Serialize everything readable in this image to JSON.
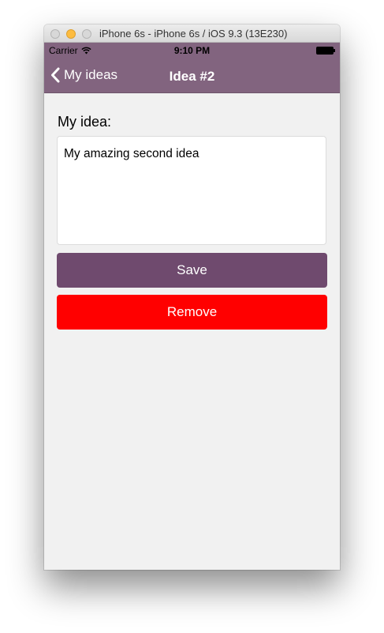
{
  "window": {
    "title": "iPhone 6s - iPhone 6s / iOS 9.3 (13E230)"
  },
  "status_bar": {
    "carrier": "Carrier",
    "time": "9:10 PM"
  },
  "nav_bar": {
    "back_label": "My ideas",
    "title": "Idea #2"
  },
  "form": {
    "label": "My idea:",
    "idea_text": "My amazing second idea",
    "save_label": "Save",
    "remove_label": "Remove"
  },
  "colors": {
    "nav_background": "#82647f",
    "save_button": "#6f4a6e",
    "remove_button": "#ff0000",
    "page_background": "#f1f1f1"
  },
  "icons": [
    "wifi-icon",
    "battery-icon",
    "chevron-left-icon"
  ]
}
